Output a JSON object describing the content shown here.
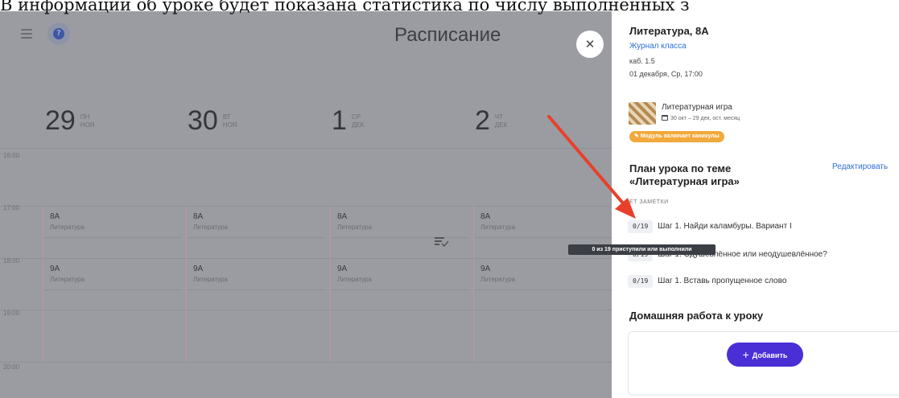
{
  "caption": "В информации об уроке будет показана статистика по числу выполненных з",
  "calendar": {
    "title": "Расписание",
    "days": [
      {
        "num": "29",
        "weekday": "ПН",
        "month": "НОЯ"
      },
      {
        "num": "30",
        "weekday": "ВТ",
        "month": "НОЯ"
      },
      {
        "num": "1",
        "weekday": "СР",
        "month": "ДЕК"
      },
      {
        "num": "2",
        "weekday": "ЧТ",
        "month": "ДЕК"
      }
    ],
    "times": [
      "16:00",
      "17:00",
      "18:00",
      "19:00",
      "20:00"
    ],
    "lessons": {
      "row17": [
        {
          "cls": "8А",
          "subject": "Литература"
        },
        {
          "cls": "8А",
          "subject": "Литература"
        },
        {
          "cls": "8А",
          "subject": "Литература"
        },
        {
          "cls": "8А",
          "subject": "Литература"
        }
      ],
      "row18": [
        {
          "cls": "9А",
          "subject": "Литература"
        },
        {
          "cls": "9А",
          "subject": "Литература"
        },
        {
          "cls": "9А",
          "subject": "Литература"
        },
        {
          "cls": "9А",
          "subject": "Литература"
        }
      ]
    },
    "icons": {
      "menu": "menu-icon",
      "help": "help-icon",
      "close": "close-icon",
      "checklist": "checklist-icon"
    }
  },
  "panel": {
    "title": "Литература, 8А",
    "journal_link": "Журнал класса",
    "room": "каб. 1.5",
    "datetime": "01 декабря, Ср, 17:00",
    "module": {
      "name": "Литературная игра",
      "dates": "30 окт – 29 дек, ост. месяц",
      "badge": "Модуль включает каникулы"
    },
    "plan_title": "План урока по теме «Литературная игра»",
    "edit_label": "Редактировать",
    "notes_label": "ЕТ ЗАМЕТКИ",
    "steps": [
      {
        "count": "0/19",
        "label": "Шаг 1. Найди каламбуры. Вариант I"
      },
      {
        "count": "0/19",
        "label": "Шаг 1. Одушевлённое или неодушевлённое?"
      },
      {
        "count": "0/19",
        "label": "Шаг 1. Вставь пропущенное слово"
      }
    ],
    "tooltip": "0 из 19 приступили или выполнили",
    "homework_title": "Домашняя работа к уроку",
    "add_label": "Добавить"
  },
  "colors": {
    "accent": "#4b2fd6",
    "link": "#2d6fd8",
    "badge": "#f2a93b",
    "arrow": "#e8402a",
    "overlay": "#9a9ca2"
  }
}
